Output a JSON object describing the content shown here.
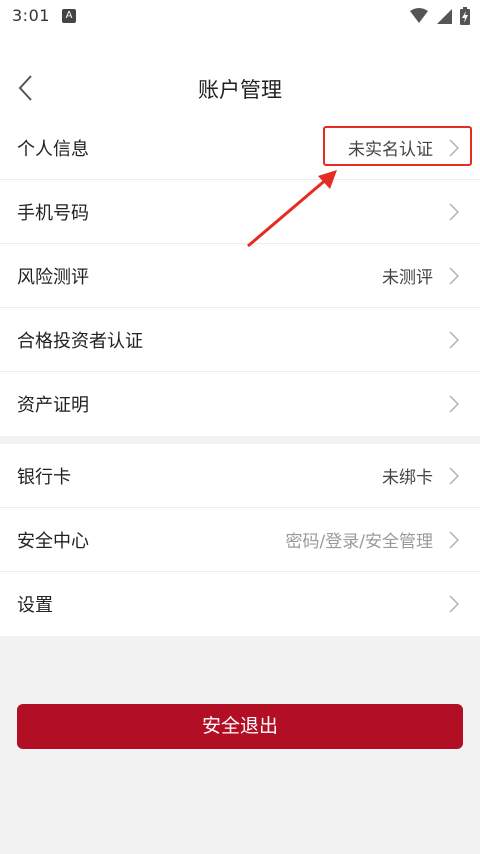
{
  "status": {
    "time": "3:01",
    "app_icon": "A"
  },
  "header": {
    "title": "账户管理"
  },
  "group1": [
    {
      "label": "个人信息",
      "value": "未实名认证"
    },
    {
      "label": "手机号码",
      "value": ""
    },
    {
      "label": "风险测评",
      "value": "未测评"
    },
    {
      "label": "合格投资者认证",
      "value": ""
    },
    {
      "label": "资产证明",
      "value": ""
    }
  ],
  "group2": [
    {
      "label": "银行卡",
      "value": "未绑卡"
    },
    {
      "label": "安全中心",
      "value": "密码/登录/安全管理"
    },
    {
      "label": "设置",
      "value": ""
    }
  ],
  "logout_label": "安全退出",
  "colors": {
    "accent": "#b20e24",
    "annotation": "#e62b22"
  }
}
